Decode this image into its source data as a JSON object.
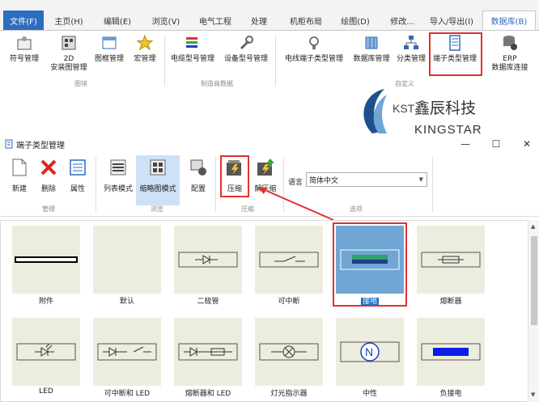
{
  "menubar": {
    "file": "文件(F)",
    "items": [
      "主页(H)",
      "编辑(E)",
      "浏览(V)",
      "电气工程",
      "处理",
      "机柜布局",
      "绘图(D)",
      "修改...",
      "导入/导出(I)",
      "数据库(B)"
    ]
  },
  "ribbon": {
    "buttons": [
      "符号管理",
      "2D\n安装图管理",
      "图框管理",
      "宏管理",
      "电缆型号管理",
      "设备型号管理",
      "电线端子类型管理",
      "数据库管理",
      "分类管理",
      "端子类型管理",
      "ERP\n数据库连接"
    ],
    "groups": [
      "图块",
      "制造商数据",
      "自定义"
    ]
  },
  "logo": {
    "prefix": "KST",
    "cn": "鑫辰科技",
    "en": "KINGSTAR"
  },
  "window": {
    "title": "端子类型管理",
    "min": "—",
    "restore": "☐",
    "close": "✕"
  },
  "toolbar": {
    "buttons": [
      "新建",
      "删除",
      "属性",
      "列表模式",
      "缩略图模式",
      "配置",
      "压缩",
      "解压缩"
    ],
    "groups": [
      "管理",
      "浏览",
      "压缩",
      "选项"
    ],
    "language_label": "语言",
    "language_value": "简体中文"
  },
  "items": [
    "附件",
    "默认",
    "二极管",
    "可中断",
    "接地",
    "熔断器",
    "LED",
    "可中断和 LED",
    "熔断器和 LED",
    "灯光指示器",
    "中性",
    "负接电"
  ],
  "colors": {
    "accent": "#2d6dbd",
    "highlight": "#e03131",
    "selected_card": "#6fa6d3"
  }
}
